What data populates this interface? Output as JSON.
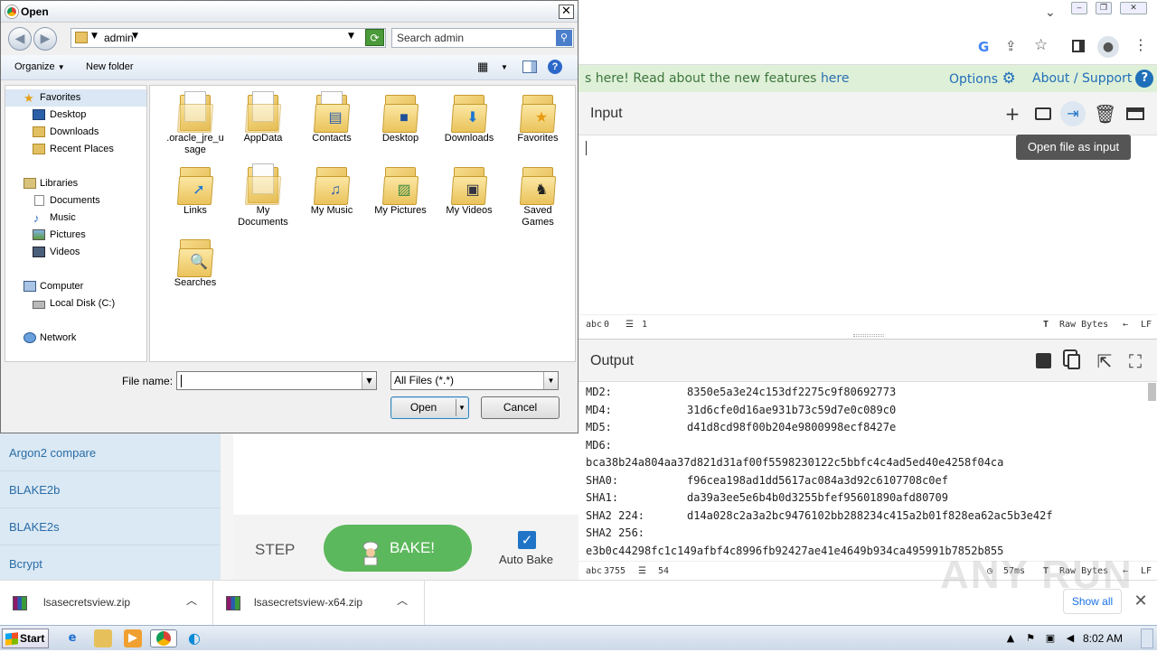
{
  "dialog": {
    "title": "Open",
    "close_label": "✕",
    "path": "admin",
    "search_placeholder": "Search admin",
    "toolbar": {
      "organize": "Organize",
      "new_folder": "New folder"
    },
    "nav": {
      "favorites": "Favorites",
      "desktop": "Desktop",
      "downloads": "Downloads",
      "recent_places": "Recent Places",
      "libraries": "Libraries",
      "documents": "Documents",
      "music": "Music",
      "pictures": "Pictures",
      "videos": "Videos",
      "computer": "Computer",
      "local_disk": "Local Disk (C:)",
      "network": "Network"
    },
    "files": [
      {
        "name": ".oracle_jre_usage",
        "line1": ".oracle_jre_u",
        "line2": "sage"
      },
      {
        "name": "AppData",
        "line1": "AppData",
        "line2": ""
      },
      {
        "name": "Contacts",
        "line1": "Contacts",
        "line2": ""
      },
      {
        "name": "Desktop",
        "line1": "Desktop",
        "line2": ""
      },
      {
        "name": "Downloads",
        "line1": "Downloads",
        "line2": ""
      },
      {
        "name": "Favorites",
        "line1": "Favorites",
        "line2": ""
      },
      {
        "name": "Links",
        "line1": "Links",
        "line2": ""
      },
      {
        "name": "My Documents",
        "line1": "My",
        "line2": "Documents"
      },
      {
        "name": "My Music",
        "line1": "My Music",
        "line2": ""
      },
      {
        "name": "My Pictures",
        "line1": "My Pictures",
        "line2": ""
      },
      {
        "name": "My Videos",
        "line1": "My Videos",
        "line2": ""
      },
      {
        "name": "Saved Games",
        "line1": "Saved",
        "line2": "Games"
      },
      {
        "name": "Searches",
        "line1": "Searches",
        "line2": ""
      }
    ],
    "file_name_label": "File name:",
    "file_name_value": "",
    "file_type": "All Files (*.*)",
    "open_label": "Open",
    "cancel_label": "Cancel"
  },
  "banner": {
    "text": "s here! Read about the new features ",
    "link": "here",
    "options": "Options",
    "about": "About / Support",
    "about_badge": "?"
  },
  "input": {
    "title": "Input",
    "tooltip": "Open file as input",
    "stats_chars": "0",
    "stats_lines": "1",
    "raw_bytes": "Raw Bytes",
    "newline": "LF"
  },
  "output": {
    "title": "Output",
    "rows": [
      {
        "label": "MD2:",
        "value": "8350e5a3e24c153df2275c9f80692773"
      },
      {
        "label": "MD4:",
        "value": "31d6cfe0d16ae931b73c59d7e0c089c0"
      },
      {
        "label": "MD5:",
        "value": "d41d8cd98f00b204e9800998ecf8427e"
      },
      {
        "label": "MD6:",
        "value": ""
      },
      {
        "label": "bca38b24a804aa37d821d31af00f5598230122c5bbfc4c4ad5ed40e4258f04ca",
        "value": ""
      },
      {
        "label": "SHA0:",
        "value": "f96cea198ad1dd5617ac084a3d92c6107708c0ef"
      },
      {
        "label": "SHA1:",
        "value": "da39a3ee5e6b4b0d3255bfef95601890afd80709"
      },
      {
        "label": "SHA2 224:",
        "value": "d14a028c2a3a2bc9476102bb288234c415a2b01f828ea62ac5b3e42f"
      },
      {
        "label": "SHA2 256:",
        "value": ""
      },
      {
        "label": "e3b0c44298fc1c149afbf4c8996fb92427ae41e4649b934ca495991b7852b855",
        "value": ""
      }
    ],
    "stats_chars": "3755",
    "stats_lines": "54",
    "time": "57ms",
    "raw_bytes": "Raw Bytes",
    "newline": "LF"
  },
  "operations": [
    "Argon2 compare",
    "BLAKE2b",
    "BLAKE2s",
    "Bcrypt"
  ],
  "controls": {
    "step": "STEP",
    "bake": "BAKE!",
    "auto_bake": "Auto Bake"
  },
  "downloads": {
    "items": [
      "lsasecretsview.zip",
      "lsasecretsview-x64.zip"
    ],
    "show_all": "Show all"
  },
  "watermark": "ANY RUN",
  "taskbar": {
    "start": "Start",
    "clock": "8:02 AM"
  }
}
